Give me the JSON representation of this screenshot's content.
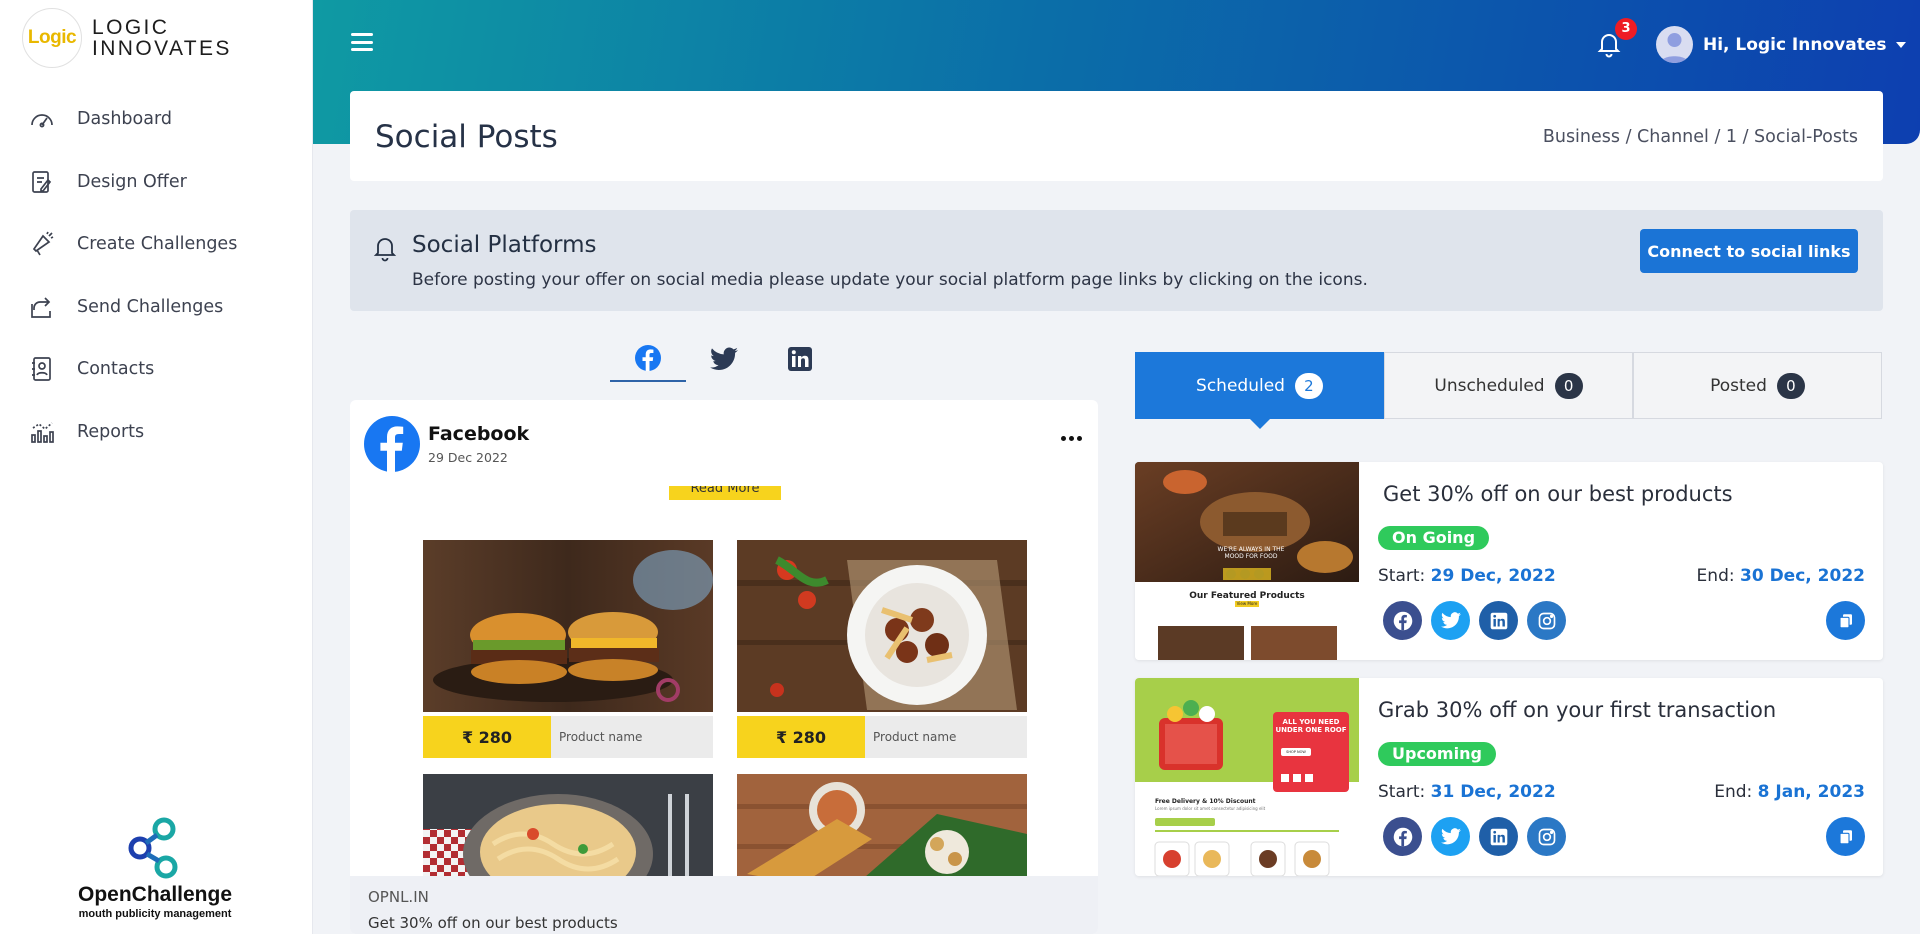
{
  "brand": {
    "logo_text": "Logic",
    "name": "LOGIC INNOVATES"
  },
  "sidebar": {
    "items": [
      {
        "label": "Dashboard",
        "icon": "gauge-icon"
      },
      {
        "label": "Design Offer",
        "icon": "design-icon"
      },
      {
        "label": "Create Challenges",
        "icon": "megaphone-icon"
      },
      {
        "label": "Send Challenges",
        "icon": "share-icon"
      },
      {
        "label": "Contacts",
        "icon": "contact-book-icon"
      },
      {
        "label": "Reports",
        "icon": "chart-icon"
      }
    ],
    "footer_title": "OpenChallenge",
    "footer_subtitle": "mouth publicity management"
  },
  "header": {
    "notifications": "3",
    "greeting": "Hi, Logic Innovates"
  },
  "page": {
    "title": "Social Posts",
    "breadcrumb": "Business / Channel / 1 / Social-Posts"
  },
  "banner": {
    "title": "Social Platforms",
    "description": "Before posting your offer on social media please update your social platform page links by clicking on the icons.",
    "button": "Connect to social links"
  },
  "platform_tabs": [
    "facebook",
    "twitter",
    "linkedin"
  ],
  "post": {
    "name": "Facebook",
    "date": "29 Dec 2022",
    "read_more": "Read More",
    "products": [
      {
        "price": "₹ 280",
        "name": "Product name"
      },
      {
        "price": "₹ 280",
        "name": "Product name"
      }
    ],
    "site": "OPNL.IN",
    "caption": "Get 30% off on our best products"
  },
  "schedule_tabs": [
    {
      "label": "Scheduled",
      "count": "2",
      "active": true
    },
    {
      "label": "Unscheduled",
      "count": "0",
      "active": false
    },
    {
      "label": "Posted",
      "count": "0",
      "active": false
    }
  ],
  "offers": [
    {
      "title": "Get 30% off on our best products",
      "status": "On Going",
      "start_label": "Start:",
      "start": "29 Dec, 2022",
      "end_label": "End:",
      "end": "30 Dec, 2022",
      "thumb_tagline": "WE'RE ALWAYS IN THE MOOD FOR FOOD",
      "thumb_heading": "Our Featured Products",
      "thumb_button": "View More"
    },
    {
      "title": "Grab 30% off on your first transaction",
      "status": "Upcoming",
      "start_label": "Start:",
      "start": "31 Dec, 2022",
      "end_label": "End:",
      "end": "8 Jan, 2023",
      "thumb_promo": "ALL YOU NEED UNDER ONE ROOF",
      "thumb_shop": "SHOP NOW",
      "thumb_heading": "Free Delivery & 10% Discount",
      "thumb_lorem": "Lorem ipsum dolor sit amet consectetur adipisicing elit"
    }
  ],
  "colors": {
    "accent": "#1c78da",
    "status_green": "#2fca5c",
    "facebook": "#1877f2",
    "twitter": "#1da1f2",
    "linkedin": "#0a66c2",
    "instagram": "#2b78c5"
  }
}
